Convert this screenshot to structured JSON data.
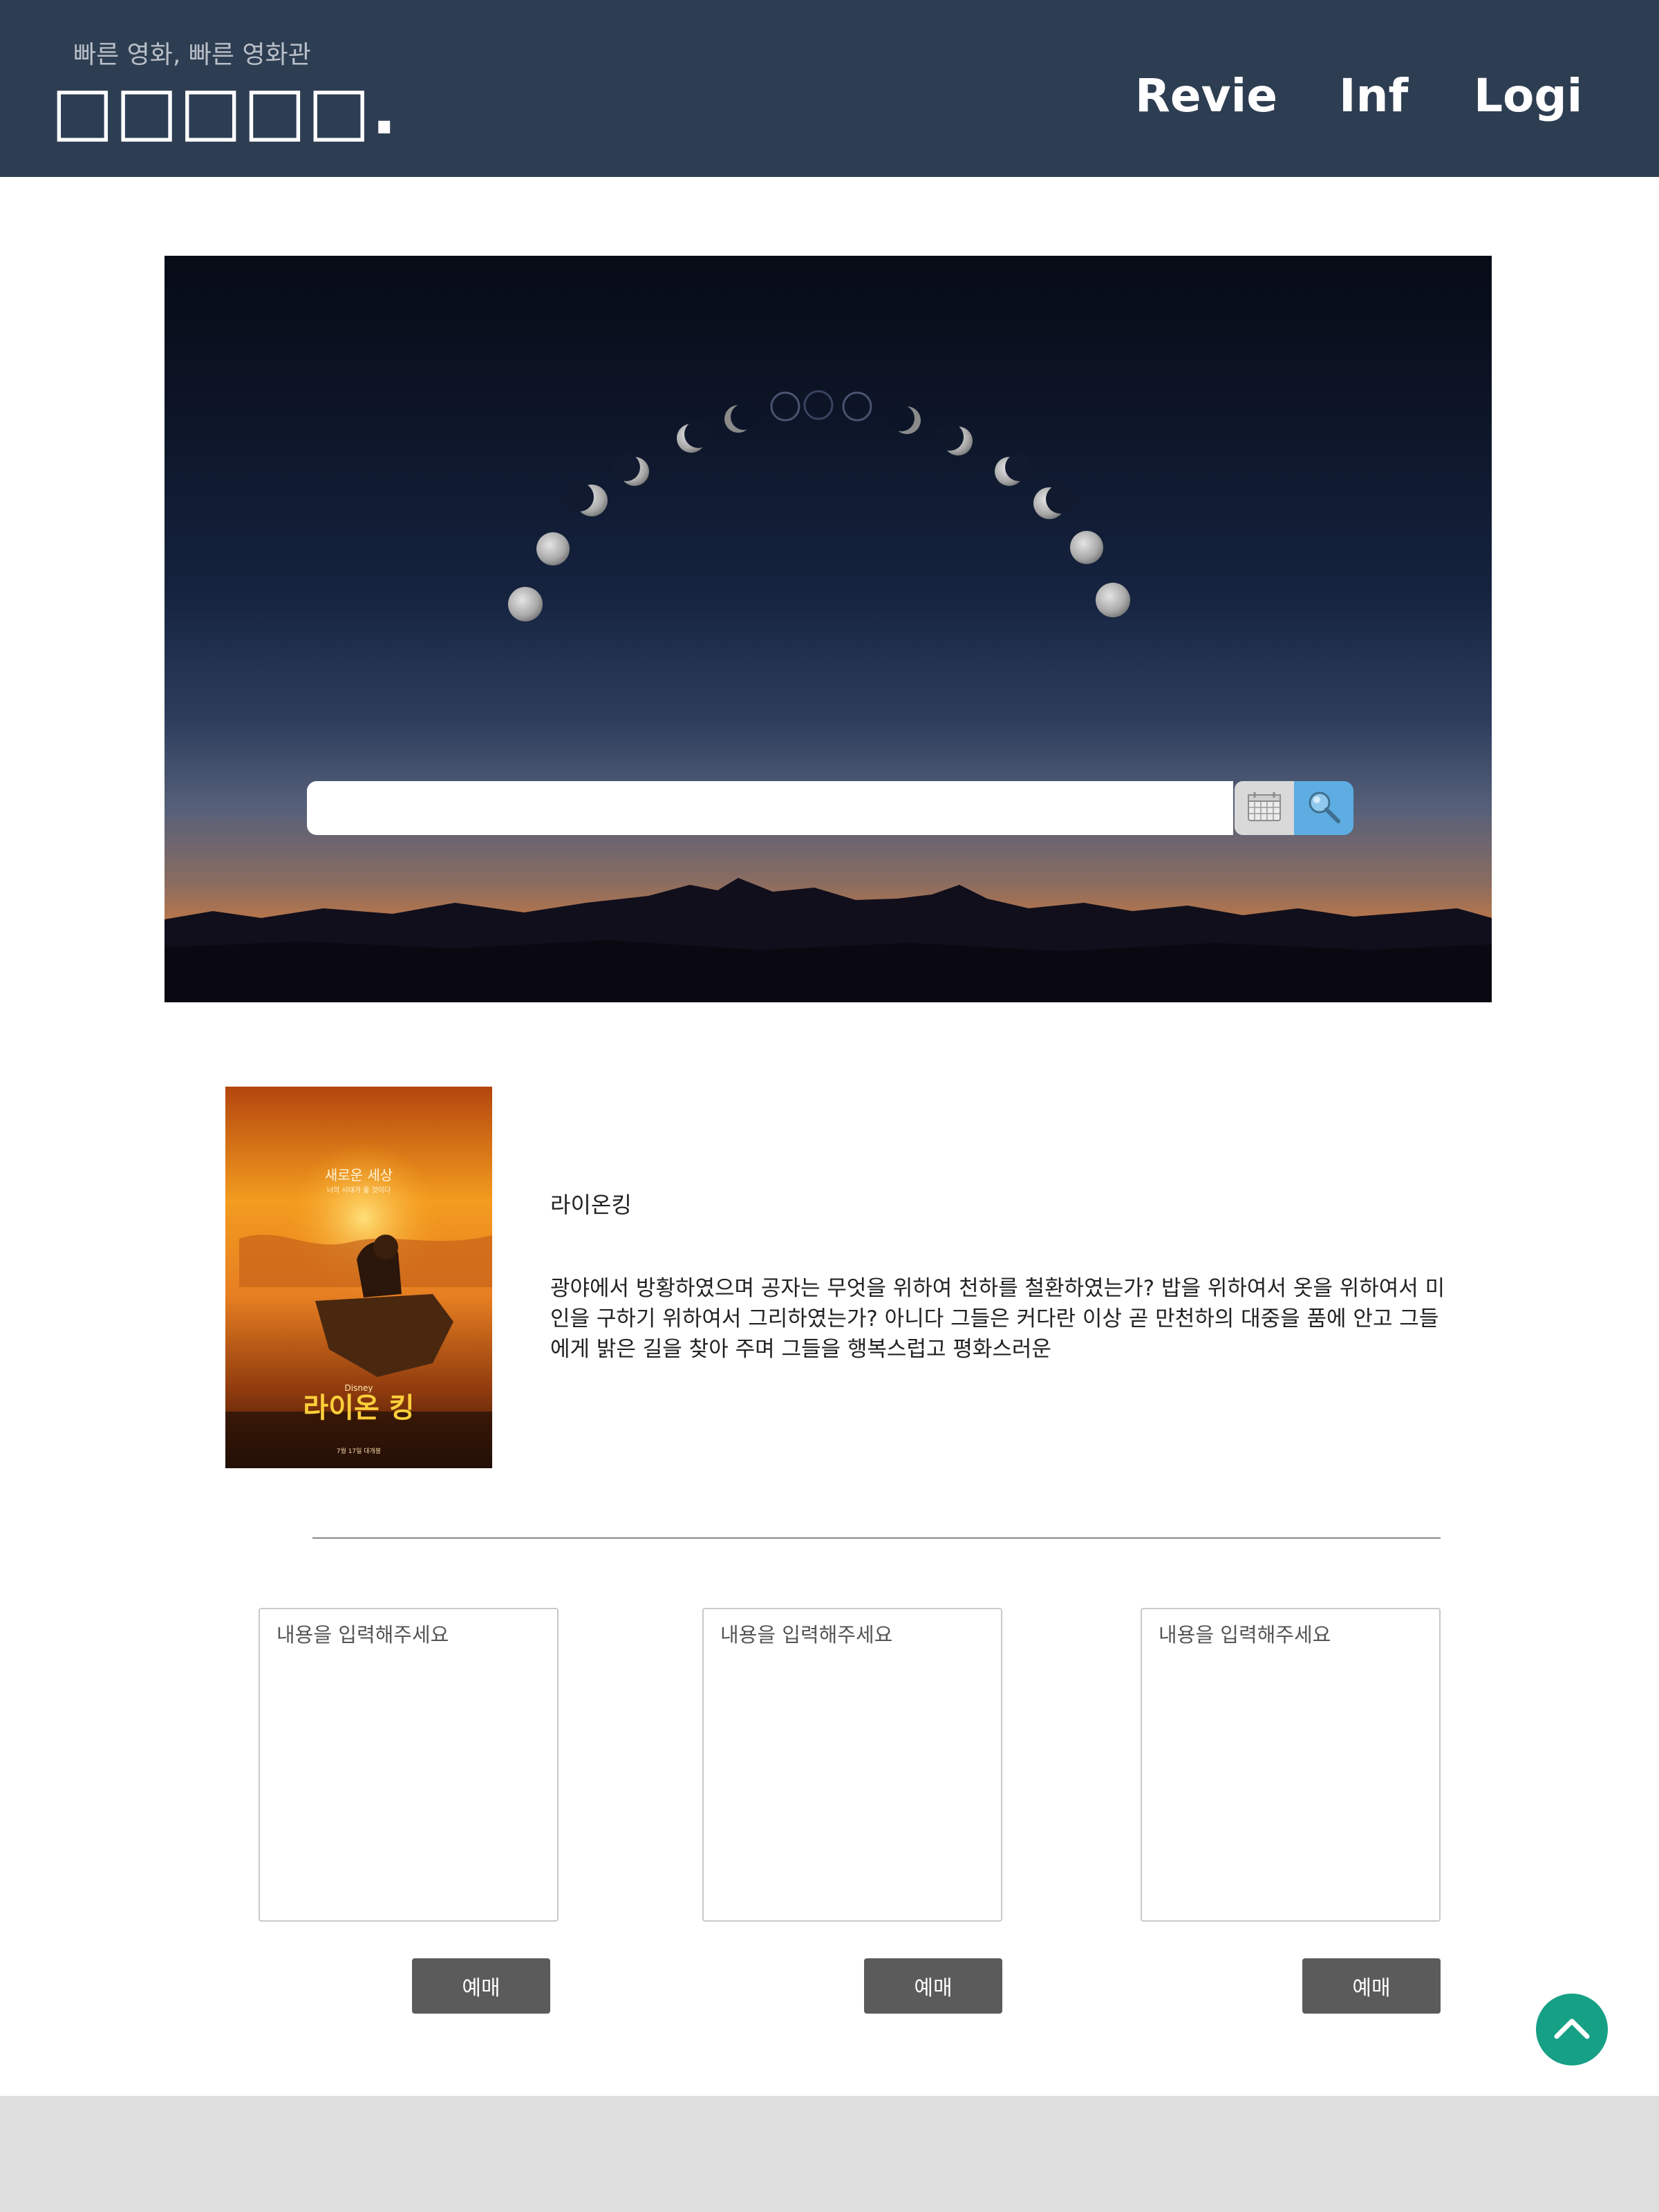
{
  "header": {
    "tagline": "빠른 영화, 빠른 영화관",
    "logo": "□□□□□.",
    "nav": {
      "review": "Revie",
      "info": "Inf",
      "login": "Logi"
    }
  },
  "hero": {
    "search": {
      "value": "",
      "placeholder": ""
    },
    "calendar_icon": "calendar-icon",
    "search_icon": "search-icon"
  },
  "movie": {
    "poster": {
      "top_text": "새로운 세상",
      "sub_text": "너의 시대가 올 것이다",
      "brand": "Disney",
      "title": "라이온 킹",
      "release": "7월 17일 대개봉"
    },
    "title": "라이온킹",
    "description": "광야에서 방황하였으며 공자는 무엇을 위하여 천하를 철환하였는가? 밥을 위하여서 옷을 위하여서 미인을 구하기 위하여서 그리하였는가? 아니다 그들은 커다란 이상 곧 만천하의 대중을 품에 안고 그들에게 밝은 길을 찾아 주며 그들을 행복스럽고 평화스러운"
  },
  "reviews": [
    {
      "placeholder": "내용을 입력해주세요",
      "value": "",
      "button": "예매"
    },
    {
      "placeholder": "내용을 입력해주세요",
      "value": "",
      "button": "예매"
    },
    {
      "placeholder": "내용을 입력해주세요",
      "value": "",
      "button": "예매"
    }
  ],
  "scroll_top_icon": "chevron-up-icon",
  "colors": {
    "header_bg": "#2e3e52",
    "search_button": "#5dade2",
    "book_button": "#5b5b5b",
    "top_button": "#16a085",
    "footer_bg": "#dedede"
  }
}
